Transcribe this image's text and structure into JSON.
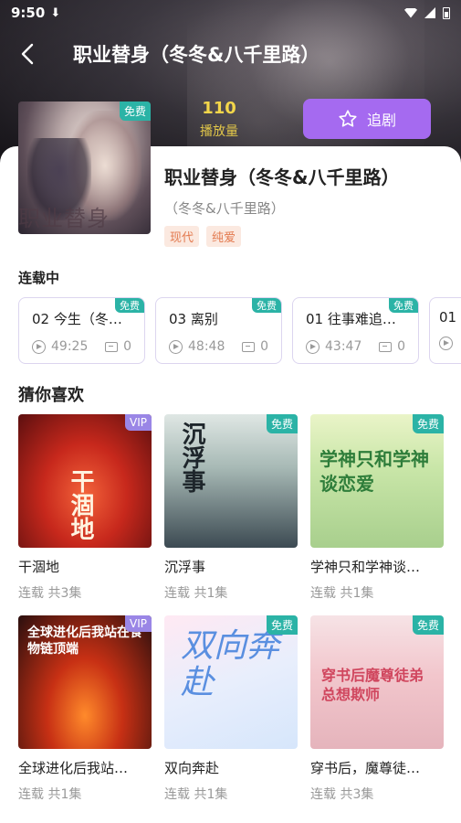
{
  "status_bar": {
    "time": "9:50"
  },
  "nav": {
    "title": "职业替身（冬冬&八千里路）"
  },
  "stats": {
    "play_count": "110",
    "play_label": "播放量"
  },
  "follow": {
    "label": "追剧"
  },
  "book": {
    "cover_badge": "免费",
    "cover_text": "职业替身",
    "title": "职业替身（冬冬&八千里路）",
    "author": "（冬冬&八千里路）",
    "tags": [
      "现代",
      "纯爱"
    ]
  },
  "sections": {
    "serial": "连载中",
    "guess": "猜你喜欢"
  },
  "episodes": [
    {
      "title": "02 今生（冬…",
      "duration": "49:25",
      "comments": "0",
      "badge": "免费"
    },
    {
      "title": "03 离别",
      "duration": "48:48",
      "comments": "0",
      "badge": "免费"
    },
    {
      "title": "01 往事难追…",
      "duration": "43:47",
      "comments": "0",
      "badge": "免费"
    },
    {
      "title": "01"
    }
  ],
  "recommendations": [
    {
      "name": "干涸地",
      "meta": "连载 共3集",
      "badge": "VIP",
      "art_text": "干涸地"
    },
    {
      "name": "沉浮事",
      "meta": "连载 共1集",
      "badge": "免费",
      "art_text": "沉浮事"
    },
    {
      "name": "学神只和学神谈…",
      "meta": "连载 共1集",
      "badge": "免费",
      "art_text": "学神只和学神谈恋爱"
    },
    {
      "name": "全球进化后我站…",
      "meta": "连载 共1集",
      "badge": "VIP",
      "art_text": "全球进化后我站在食物链顶端"
    },
    {
      "name": "双向奔赴",
      "meta": "连载 共1集",
      "badge": "免费",
      "art_text": "双向奔赴"
    },
    {
      "name": "穿书后，魔尊徒…",
      "meta": "连载 共3集",
      "badge": "免费",
      "art_text": "穿书后魔尊徒弟总想欺师"
    }
  ]
}
